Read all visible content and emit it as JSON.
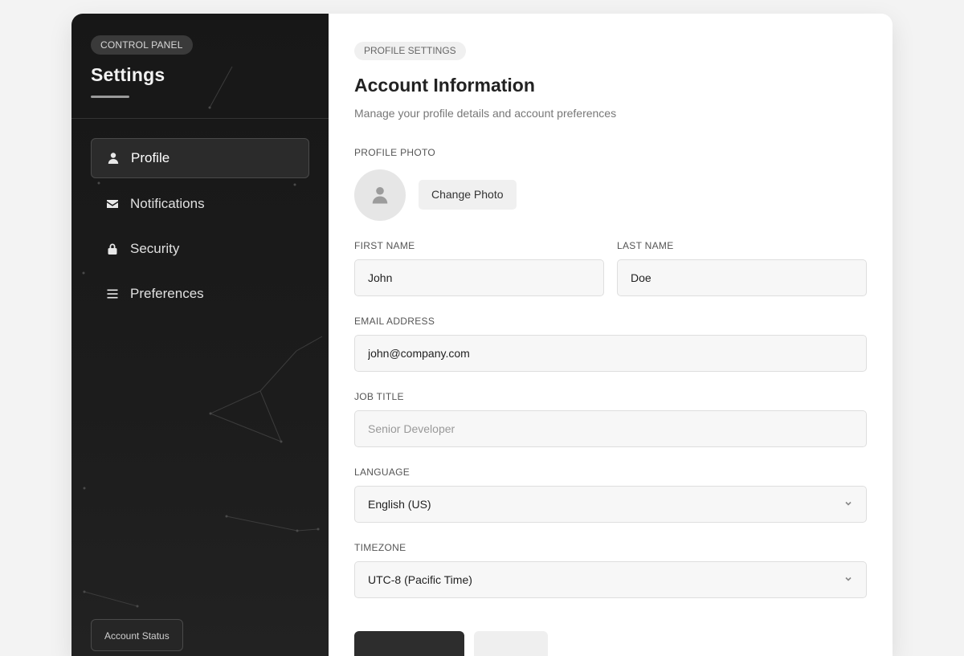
{
  "sidebar": {
    "badge": "CONTROL PANEL",
    "title": "Settings",
    "nav": [
      {
        "label": "Profile",
        "icon": "user-icon",
        "active": true
      },
      {
        "label": "Notifications",
        "icon": "envelope-icon",
        "active": false
      },
      {
        "label": "Security",
        "icon": "lock-icon",
        "active": false
      },
      {
        "label": "Preferences",
        "icon": "menu-lines-icon",
        "active": false
      }
    ],
    "account_status_label": "Account Status"
  },
  "main": {
    "badge": "PROFILE SETTINGS",
    "title": "Account Information",
    "subtitle": "Manage your profile details and account preferences",
    "photo": {
      "label": "PROFILE PHOTO",
      "button": "Change Photo"
    },
    "first_name": {
      "label": "FIRST NAME",
      "value": "John"
    },
    "last_name": {
      "label": "LAST NAME",
      "value": "Doe"
    },
    "email": {
      "label": "EMAIL ADDRESS",
      "value": "john@company.com"
    },
    "job_title": {
      "label": "JOB TITLE",
      "placeholder": "Senior Developer"
    },
    "language": {
      "label": "LANGUAGE",
      "value": "English (US)"
    },
    "timezone": {
      "label": "TIMEZONE",
      "value": "UTC-8 (Pacific Time)"
    }
  },
  "colors": {
    "sidebar_bg": "#1a1a1a",
    "primary_button": "#2d2d2d",
    "field_bg": "#f7f7f7"
  }
}
